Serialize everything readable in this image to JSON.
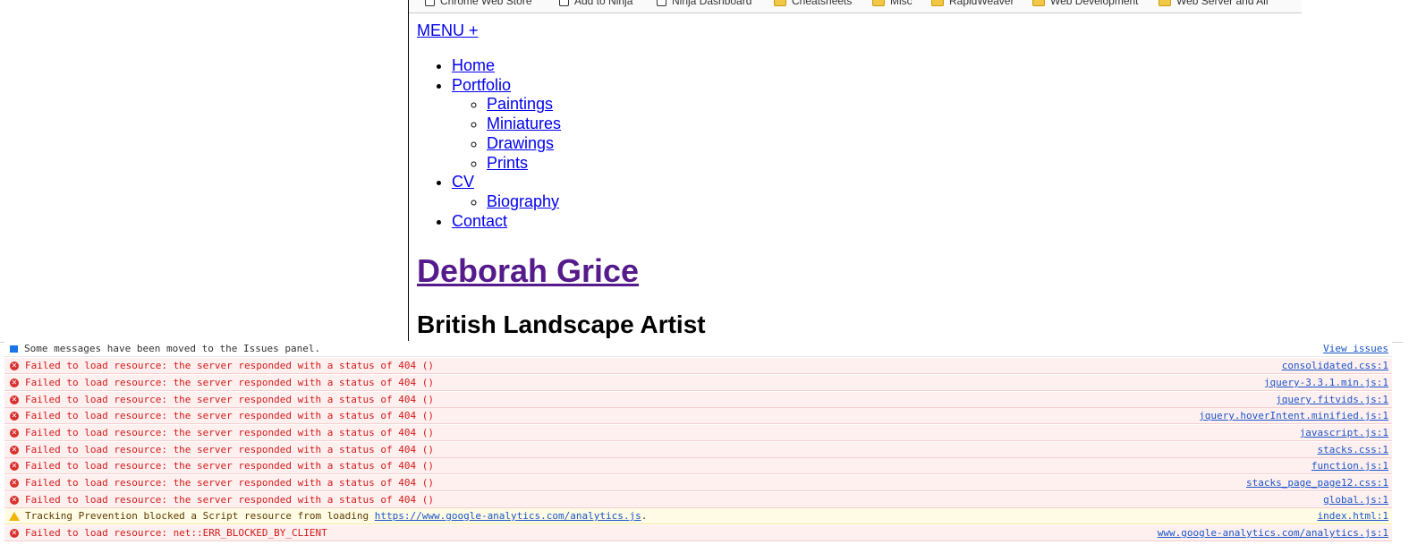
{
  "bookmarks": [
    {
      "label": "Chrome Web Store",
      "kind": "page"
    },
    {
      "label": "Add to Ninja",
      "kind": "page"
    },
    {
      "label": "Ninja Dashboard",
      "kind": "page"
    },
    {
      "label": "Cheatsheets",
      "kind": "folder"
    },
    {
      "label": "Misc",
      "kind": "folder"
    },
    {
      "label": "RapidWeaver",
      "kind": "folder"
    },
    {
      "label": "Web Development",
      "kind": "folder"
    },
    {
      "label": "Web Server and All",
      "kind": "folder"
    }
  ],
  "page": {
    "menu_label": "MENU +",
    "nav": {
      "home": "Home",
      "portfolio": "Portfolio",
      "paintings": "Paintings",
      "miniatures": "Miniatures",
      "drawings": "Drawings",
      "prints": "Prints",
      "cv": "CV",
      "biography": "Biography",
      "contact": "Contact"
    },
    "site_title": "Deborah Grice",
    "subtitle": "British Landscape Artist"
  },
  "console": {
    "issues_notice": "Some messages have been moved to the Issues panel.",
    "view_issues": "View issues",
    "error_msg": "Failed to load resource: the server responded with a status of 404 ()",
    "errors": [
      "consolidated.css:1",
      "jquery-3.3.1.min.js:1",
      "jquery.fitvids.js:1",
      "jquery.hoverIntent.minified.js:1",
      "javascript.js:1",
      "stacks.css:1",
      "function.js:1",
      "stacks_page_page12.css:1",
      "global.js:1"
    ],
    "warning": {
      "prefix": "Tracking Prevention blocked a Script resource from loading",
      "link": "https://www.google-analytics.com/analytics.js",
      "suffix": ".",
      "source": "index.html:1"
    },
    "blocked": {
      "msg": "Failed to load resource: net::ERR_BLOCKED_BY_CLIENT",
      "source": "www.google-analytics.com/analytics.js:1"
    }
  },
  "colors": {
    "link": "#0000ee",
    "visited": "#551a8b",
    "error_text": "#d21a1a",
    "error_bg": "#fff0f0",
    "warn_bg": "#fffbe5"
  }
}
